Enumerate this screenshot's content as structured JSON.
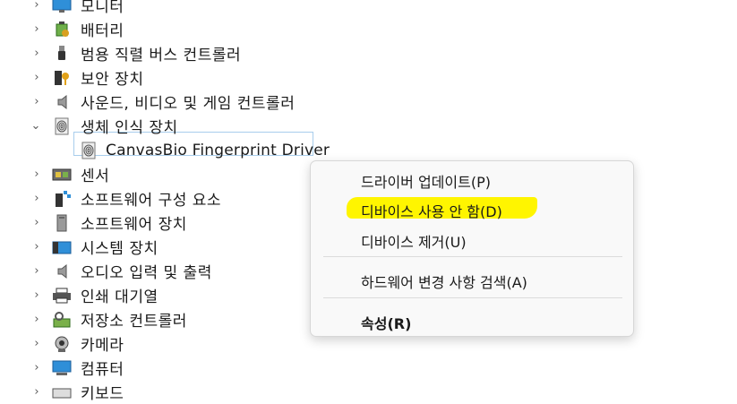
{
  "tree": {
    "items": [
      {
        "label": "모니터",
        "expanded": false,
        "icon": "monitor-icon"
      },
      {
        "label": "배터리",
        "expanded": false,
        "icon": "battery-icon"
      },
      {
        "label": "범용 직렬 버스 컨트롤러",
        "expanded": false,
        "icon": "usb-icon"
      },
      {
        "label": "보안 장치",
        "expanded": false,
        "icon": "security-key-icon"
      },
      {
        "label": "사운드, 비디오 및 게임 컨트롤러",
        "expanded": false,
        "icon": "speaker-icon"
      },
      {
        "label": "생체 인식 장치",
        "expanded": true,
        "icon": "fingerprint-icon"
      },
      {
        "label": "CanvasBio Fingerprint Driver",
        "child": true,
        "selected": true,
        "icon": "fingerprint-icon"
      },
      {
        "label": "센서",
        "expanded": false,
        "icon": "sensor-icon"
      },
      {
        "label": "소프트웨어 구성 요소",
        "expanded": false,
        "icon": "software-component-icon"
      },
      {
        "label": "소프트웨어 장치",
        "expanded": false,
        "icon": "software-device-icon"
      },
      {
        "label": "시스템 장치",
        "expanded": false,
        "icon": "system-device-icon"
      },
      {
        "label": "오디오 입력 및 출력",
        "expanded": false,
        "icon": "speaker-icon"
      },
      {
        "label": "인쇄 대기열",
        "expanded": false,
        "icon": "printer-icon"
      },
      {
        "label": "저장소 컨트롤러",
        "expanded": false,
        "icon": "storage-controller-icon"
      },
      {
        "label": "카메라",
        "expanded": false,
        "icon": "camera-icon"
      },
      {
        "label": "컴퓨터",
        "expanded": false,
        "icon": "computer-icon"
      },
      {
        "label": "키보드",
        "expanded": false,
        "icon": "keyboard-icon"
      }
    ]
  },
  "context_menu": {
    "update_driver": "드라이버 업데이트(P)",
    "disable_device": "디바이스 사용 안 함(D)",
    "uninstall_device": "디바이스 제거(U)",
    "scan_changes": "하드웨어 변경 사항 검색(A)",
    "properties": "속성(R)"
  },
  "colors": {
    "highlight": "#fff500",
    "selection_border": "#a8cdec",
    "menu_bg": "#f9f9f9"
  }
}
